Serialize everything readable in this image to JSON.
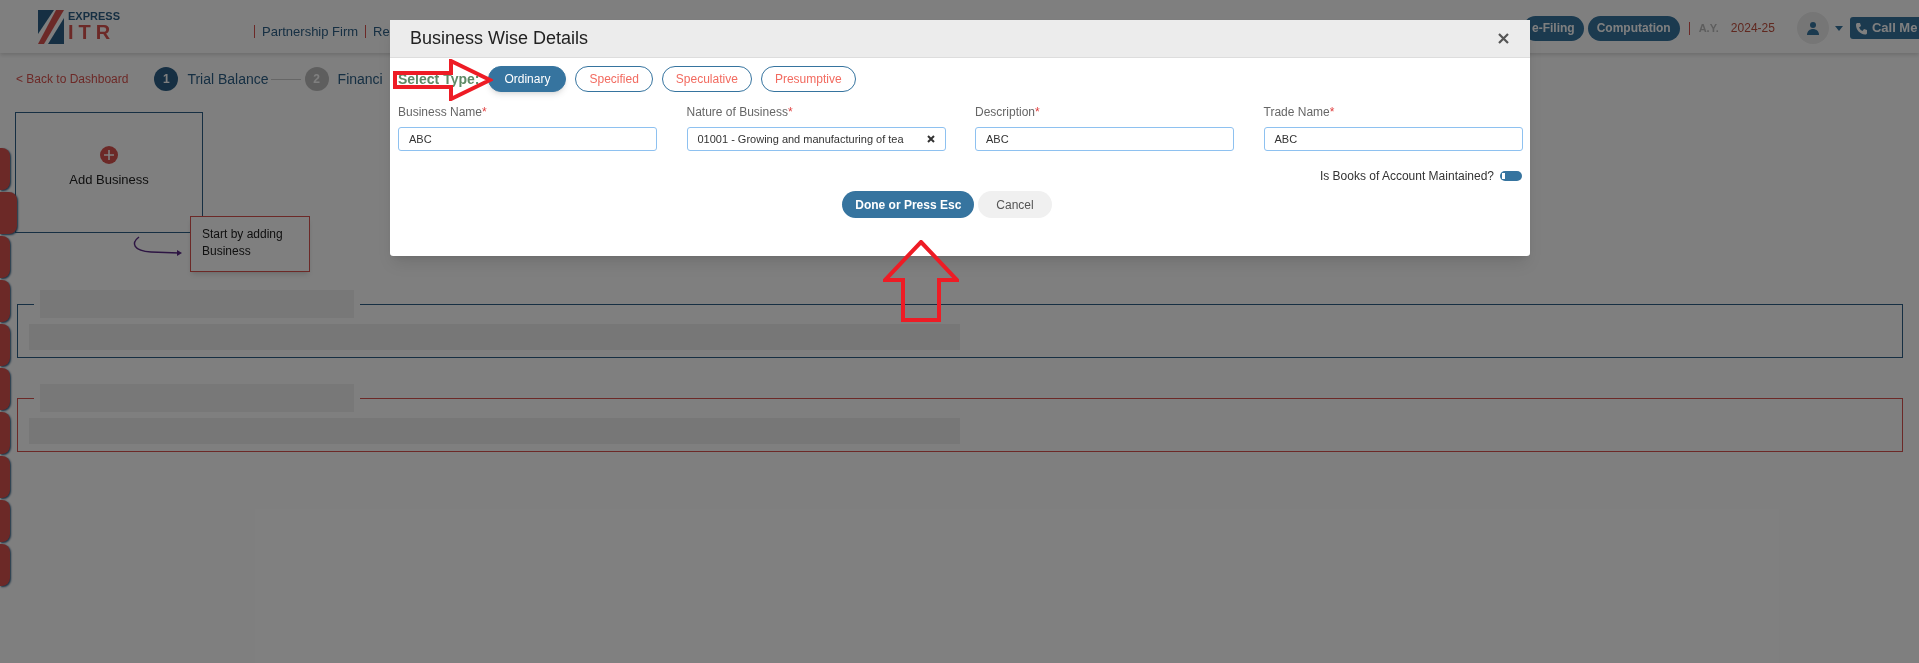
{
  "logo": {
    "top": "EXPRESS",
    "bottom": "ITR"
  },
  "header": {
    "nav_links": [
      "Partnership Firm",
      "Re"
    ],
    "buttons": [
      "e-Filing",
      "Computation"
    ],
    "ay_label": "A.Y.",
    "ay_value": "2024-25",
    "call_button": "Call Me"
  },
  "steps": {
    "back_link": "< Back to Dashboard",
    "items": [
      {
        "number": "1",
        "label": "Trial Balance",
        "selected": true
      },
      {
        "number": "2",
        "label": "Financi",
        "selected": false
      }
    ]
  },
  "add_business_card": {
    "label": "Add Business"
  },
  "tooltip": "Start by adding Business",
  "modal": {
    "title": "Business Wise Details",
    "select_type_label": "Select Type:",
    "types": [
      {
        "label": "Ordinary",
        "selected": true
      },
      {
        "label": "Specified",
        "selected": false
      },
      {
        "label": "Speculative",
        "selected": false
      },
      {
        "label": "Presumptive",
        "selected": false
      }
    ],
    "fields": [
      {
        "label": "Business Name",
        "mark": "*",
        "value": "ABC",
        "clearable": false
      },
      {
        "label": "Nature of Business",
        "mark": "*",
        "value": "01001 - Growing and manufacturing of tea",
        "clearable": true
      },
      {
        "label": "Description",
        "mark": "*",
        "value": "ABC",
        "clearable": false
      },
      {
        "label": "Trade Name",
        "mark": "*",
        "value": "ABC",
        "clearable": false
      }
    ],
    "toggle": {
      "label": "Is Books of Account Maintained?",
      "on": false
    },
    "buttons": [
      {
        "label": "Done or Press Esc",
        "kind": "primary"
      },
      {
        "label": "Cancel",
        "kind": "secondary"
      }
    ]
  }
}
